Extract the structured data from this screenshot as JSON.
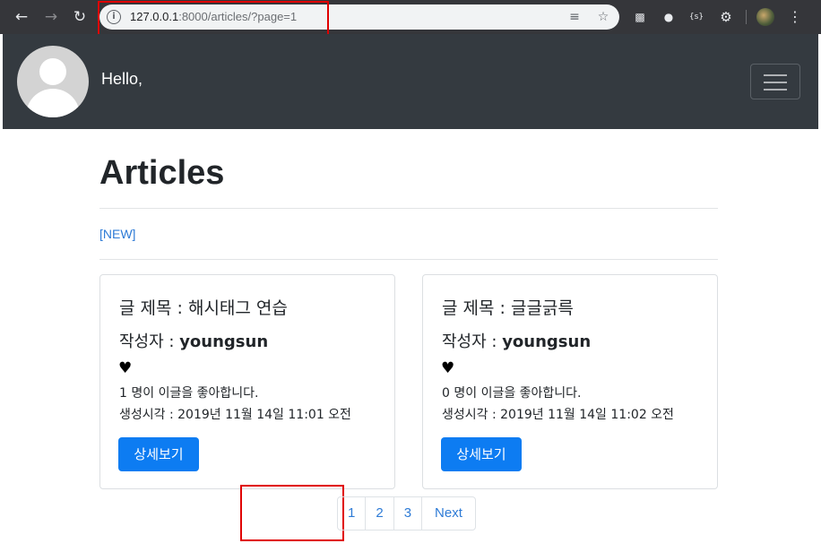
{
  "browser": {
    "url_host": "127.0.0.1",
    "url_rest": ":8000/articles/?page=1"
  },
  "navbar": {
    "greeting": "Hello,"
  },
  "page": {
    "title": "Articles",
    "new_link": "[NEW]"
  },
  "articles": [
    {
      "title_prefix": "글 제목 : ",
      "title": "해시태그 연습",
      "author_prefix": "작성자 : ",
      "author": "youngsun",
      "heart": "♥",
      "likes": "1 명이 이글을 좋아합니다.",
      "created": "생성시각 : 2019년 11월 14일 11:01 오전",
      "button": "상세보기"
    },
    {
      "title_prefix": "글 제목 : ",
      "title": "글글긁륵",
      "author_prefix": "작성자 : ",
      "author": "youngsun",
      "heart": "♥",
      "likes": "0 명이 이글을 좋아합니다.",
      "created": "생성시각 : 2019년 11월 14일 11:02 오전",
      "button": "상세보기"
    }
  ],
  "pagination": {
    "pages": [
      "1",
      "2",
      "3"
    ],
    "next": "Next"
  }
}
